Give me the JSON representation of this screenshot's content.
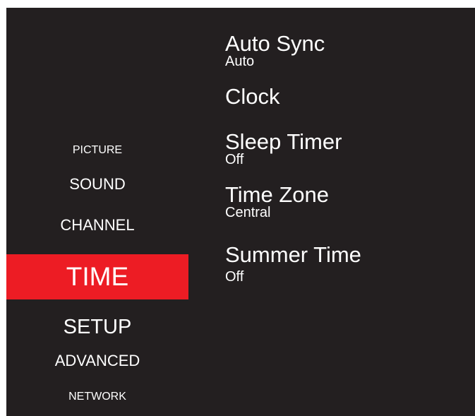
{
  "menu": {
    "items": [
      {
        "label": "PICTURE"
      },
      {
        "label": "SOUND"
      },
      {
        "label": "CHANNEL"
      },
      {
        "label": "TIME",
        "selected": true
      },
      {
        "label": "SETUP"
      },
      {
        "label": "ADVANCED"
      },
      {
        "label": "NETWORK"
      }
    ]
  },
  "settings": [
    {
      "label": "Auto Sync",
      "value": "Auto"
    },
    {
      "label": "Clock",
      "value": ""
    },
    {
      "label": "Sleep Timer",
      "value": "Off"
    },
    {
      "label": "Time Zone",
      "value": "Central"
    },
    {
      "label": "Summer Time",
      "value": "Off"
    }
  ],
  "colors": {
    "background": "#231f20",
    "selected": "#ed1c24",
    "text": "#ffffff"
  }
}
